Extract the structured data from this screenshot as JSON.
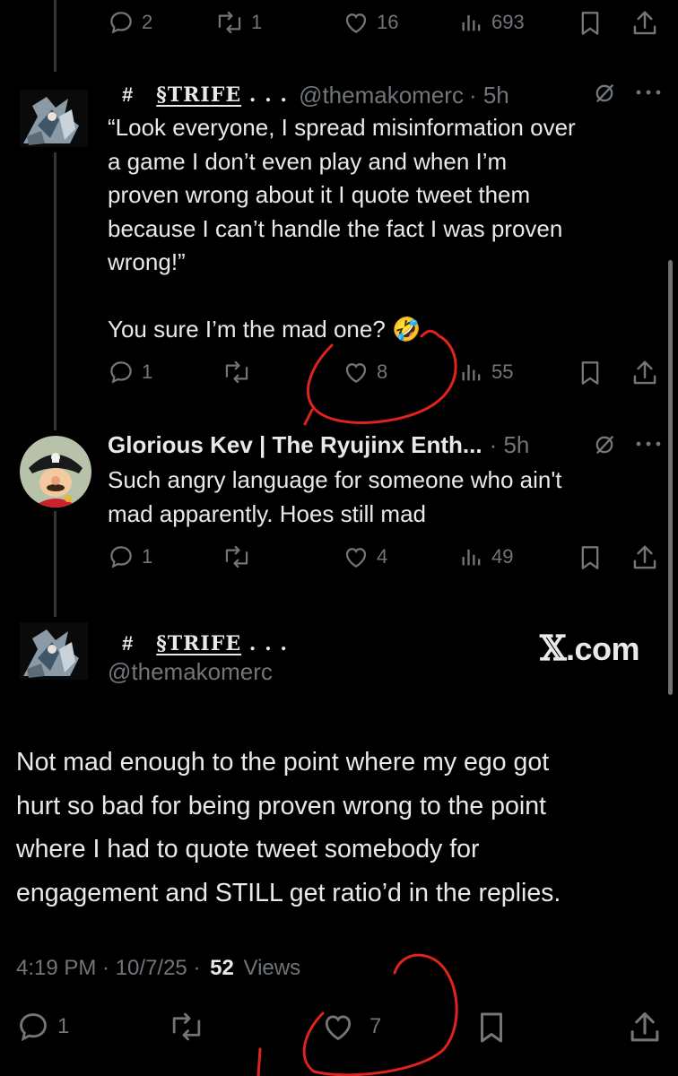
{
  "top_actions": {
    "replies": "2",
    "reposts": "1",
    "likes": "16",
    "views": "693"
  },
  "tweet1": {
    "hash": "#",
    "display_name": "§TRIFE . . .",
    "display_name_main": "§TRIFE",
    "display_name_dots": " . . .",
    "handle": "@themakomerc",
    "time": "· 5h",
    "text_lines": [
      "“Look everyone, I spread misinformation over",
      "a game I don’t even play and when I’m",
      "proven wrong about it I quote tweet them",
      "because I can’t handle the fact I was proven",
      "wrong!”"
    ],
    "text_line2": "You sure I’m the mad one? 🤣",
    "actions": {
      "replies": "1",
      "reposts": "",
      "likes": "8",
      "views": "55"
    }
  },
  "tweet2": {
    "display_name": "Glorious Kev | The Ryujinx Enth...",
    "time": "· 5h",
    "text_lines": [
      "Such angry language for someone who ain't",
      "mad apparently. Hoes still mad"
    ],
    "actions": {
      "replies": "1",
      "reposts": "",
      "likes": "4",
      "views": "49"
    }
  },
  "main_tweet": {
    "hash": "#",
    "display_name_main": "§TRIFE",
    "display_name_dots": " . . .",
    "handle": "@themakomerc",
    "watermark": ".com",
    "watermark_mark": "𝕏",
    "text_lines": [
      "Not mad enough to the point where my ego got",
      "hurt so bad for being proven wrong to the point",
      "where I had to quote tweet somebody for",
      "engagement and STILL get ratio’d in the replies."
    ],
    "timestamp": "4:19 PM · 10/7/25 ·",
    "views_count": "52",
    "views_label": "Views",
    "actions": {
      "replies": "1",
      "reposts": "",
      "likes": "7"
    }
  },
  "colors": {
    "background": "#000000",
    "text": "#e7e9ea",
    "secondary": "#71767b",
    "annotation": "#e0231c"
  },
  "icons": [
    "reply-icon",
    "repost-icon",
    "like-icon",
    "views-icon",
    "bookmark-icon",
    "share-icon",
    "grok-icon",
    "more-icon"
  ]
}
